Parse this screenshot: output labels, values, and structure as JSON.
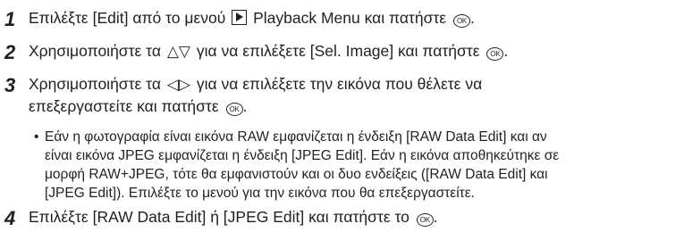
{
  "steps": [
    {
      "number": "1",
      "parts": [
        "Επιλέξτε [Edit] από το μενού",
        "Playback Menu και πατήστε",
        "."
      ]
    },
    {
      "number": "2",
      "parts": [
        "Χρησιμοποιήστε τα",
        "△▽",
        "για να επιλέξετε [Sel. Image] και πατήστε",
        "."
      ]
    },
    {
      "number": "3",
      "line1_parts": [
        "Χρησιμοποιήστε τα",
        "◁▷",
        "για να επιλέξετε την εικόνα που θέλετε να"
      ],
      "line2_parts": [
        "επεξεργαστείτε και πατήστε",
        "."
      ]
    },
    {
      "number": "4",
      "parts": [
        "Επιλέξτε [RAW Data Edit] ή [JPEG Edit] και πατήστε το",
        "."
      ]
    }
  ],
  "note": {
    "bullet": "•",
    "lines": [
      "Εάν η φωτογραφία είναι εικόνα RAW εμφανίζεται η ένδειξη [RAW Data Edit] και αν",
      "είναι εικόνα JPEG εμφανίζεται η ένδειξη [JPEG Edit]. Εάν η εικόνα αποθηκεύτηκε σε",
      "μορφή RAW+JPEG, τότε θα εμφανιστούν και οι δυο ενδείξεις ([RAW Data Edit] και",
      "[JPEG Edit]). Επιλέξτε το μενού για την εικόνα που θα επεξεργαστείτε."
    ]
  },
  "icons": {
    "playback": "playback-icon",
    "ok_button": "ok-button-icon",
    "ok_text": "OK"
  }
}
